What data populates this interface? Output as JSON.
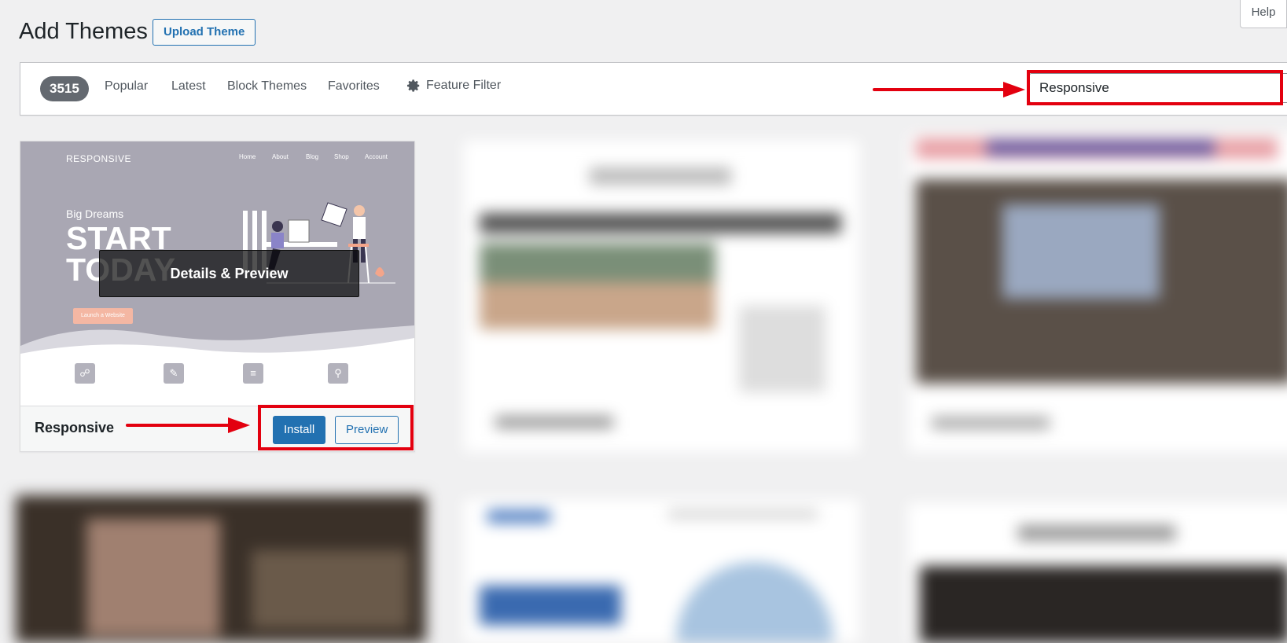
{
  "header": {
    "title": "Add Themes",
    "upload_label": "Upload Theme",
    "help_label": "Help"
  },
  "filter_bar": {
    "count": "3515",
    "links": [
      "Popular",
      "Latest",
      "Block Themes",
      "Favorites"
    ],
    "feature_filter": "Feature Filter",
    "search_value": "Responsive"
  },
  "featured_theme": {
    "name": "Responsive",
    "install_label": "Install",
    "preview_label": "Preview",
    "overlay_label": "Details & Preview",
    "screenshot": {
      "brand": "RESPONSIVE",
      "nav": [
        "Home",
        "About",
        "Blog",
        "Shop",
        "Account"
      ],
      "tagline": "Big Dreams",
      "headline_1": "START",
      "headline_2": "TODAY",
      "cta": "Launch a Website"
    }
  },
  "colors": {
    "accent": "#2271b1",
    "annotation": "#e3000f",
    "badge": "#646970"
  }
}
